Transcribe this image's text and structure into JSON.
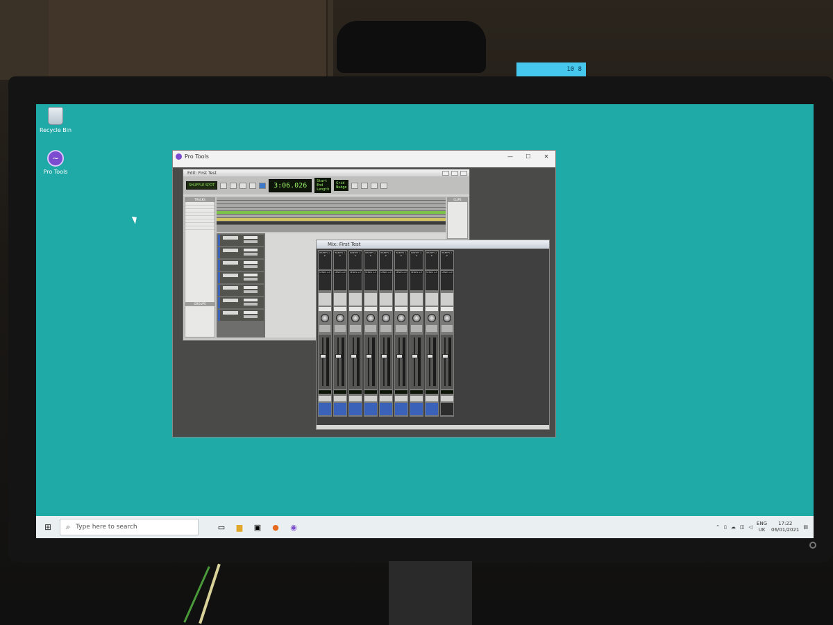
{
  "desktop": {
    "icons": [
      {
        "label": "Recycle Bin",
        "icon": "recycle-bin-icon"
      },
      {
        "label": "Pro Tools",
        "icon": "pro-tools-icon"
      }
    ],
    "background_color": "#1fa9a7"
  },
  "pro_tools": {
    "window_title": "Pro Tools",
    "edit_window": {
      "title": "Edit: First Test",
      "main_counter": "3:06.026",
      "tracks_panel_label": "TRACKS",
      "groups_panel_label": "GROUPS",
      "clips_panel_label": "CLIPS"
    },
    "mix_window": {
      "title": "Mix: First Test",
      "strip_count": 9,
      "inserts_label": "INSERTS A-E",
      "sends_label": "SENDS A-E"
    }
  },
  "taskbar": {
    "search_placeholder": "Type here to search",
    "language": "ENG",
    "region": "UK",
    "time": "17:22",
    "date": "06/01/2021"
  },
  "monitor": {
    "lcd_text": "10\n8"
  }
}
